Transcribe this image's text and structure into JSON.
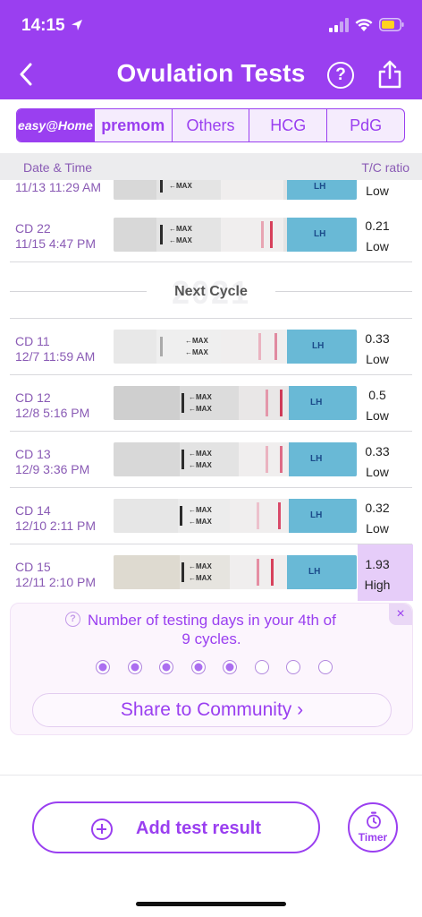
{
  "status_bar": {
    "time": "14:15"
  },
  "header": {
    "title": "Ovulation Tests",
    "help_label": "?"
  },
  "brand_tabs": [
    {
      "label": "easy@Home",
      "active": true
    },
    {
      "label": "premom",
      "active": false
    },
    {
      "label": "Others",
      "active": false
    },
    {
      "label": "HCG",
      "active": false
    },
    {
      "label": "PdG",
      "active": false
    }
  ],
  "list_header": {
    "left": "Date & Time",
    "right": "T/C ratio"
  },
  "strip_text": {
    "max": "←MAX",
    "lh": "LH",
    "brand": "easy@Home"
  },
  "rows_prev": [
    {
      "cd": "",
      "date": "11/13 11:29 AM",
      "ratio": "",
      "level": "Low"
    },
    {
      "cd": "CD 22",
      "date": "11/15 4:47 PM",
      "ratio": "0.21",
      "level": "Low"
    }
  ],
  "cycle_divider": {
    "label": "Next Cycle",
    "watermark": "2021"
  },
  "rows": [
    {
      "cd": "CD 11",
      "date": "12/7 11:59 AM",
      "ratio": "0.33",
      "level": "Low"
    },
    {
      "cd": "CD 12",
      "date": "12/8 5:16 PM",
      "ratio": "0.5",
      "level": "Low"
    },
    {
      "cd": "CD 13",
      "date": "12/9 3:36 PM",
      "ratio": "0.33",
      "level": "Low"
    },
    {
      "cd": "CD 14",
      "date": "12/10 2:11 PM",
      "ratio": "0.32",
      "level": "Low"
    },
    {
      "cd": "CD 15",
      "date": "12/11 2:10 PM",
      "ratio": "1.93",
      "level": "High"
    }
  ],
  "card": {
    "message_line1": "Number of testing days in your 4th of",
    "message_line2": "9 cycles.",
    "dots_total": 8,
    "dots_filled": 5,
    "share_label": "Share to Community ›",
    "close_label": "×",
    "help_icon": "?"
  },
  "add_button": {
    "label": "Add test result"
  },
  "timer": {
    "label": "Timer"
  },
  "colors": {
    "primary": "#9a3ff0",
    "high_highlight": "#e6cdf9",
    "test_line": "#d7405b"
  }
}
